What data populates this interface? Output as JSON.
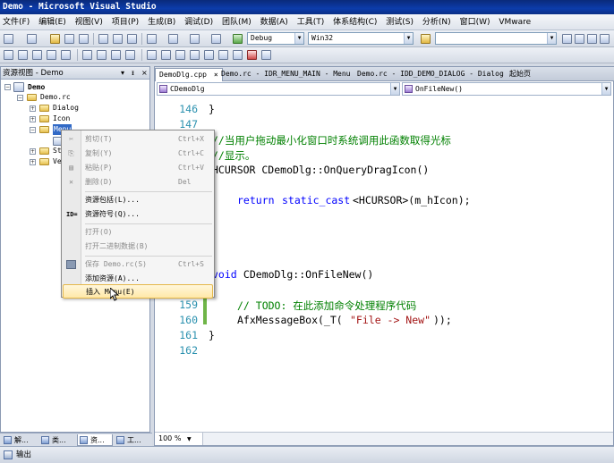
{
  "window": {
    "title": "Demo - Microsoft Visual Studio"
  },
  "menubar": [
    "文件(F)",
    "编辑(E)",
    "视图(V)",
    "项目(P)",
    "生成(B)",
    "调试(D)",
    "团队(M)",
    "数据(A)",
    "工具(T)",
    "体系结构(C)",
    "测试(S)",
    "分析(N)",
    "窗口(W)",
    "VMware"
  ],
  "toolbar": {
    "config": "Debug",
    "platform": "Win32"
  },
  "left_panel": {
    "title": "资源视图 - Demo",
    "controls": [
      "▾",
      "ᵻ",
      "×"
    ],
    "tree": {
      "root": "Demo",
      "rc": "Demo.rc",
      "items": [
        "Dialog",
        "Icon",
        "Menu",
        "Str",
        "Ver"
      ]
    },
    "bottom_tabs": [
      "解...",
      "类...",
      "资...",
      "工..."
    ]
  },
  "editor": {
    "tabs": [
      "DemoDlg.cpp",
      "Demo.rc - IDR_MENU_MAIN - Menu",
      "Demo.rc - IDD_DEMO_DIALOG - Dialog",
      "起始页"
    ],
    "nav_left": "CDemoDlg",
    "nav_right": "OnFileNew()",
    "zoom": "100 %",
    "lines": [
      {
        "no": "146",
        "text": "}"
      },
      {
        "no": "147",
        "text": ""
      },
      {
        "no": "",
        "text": "//当用户拖动最小化窗口时系统调用此函数取得光标"
      },
      {
        "no": "",
        "text": "//显示。"
      },
      {
        "no": "",
        "text": "HCURSOR CDemoDlg::OnQueryDragIcon()"
      },
      {
        "no": "",
        "text": ""
      },
      {
        "no": "",
        "text": "    return static_cast<HCURSOR>(m_hIcon);"
      },
      {
        "no": "",
        "text": ""
      },
      {
        "no": "",
        "text": ""
      },
      {
        "no": "",
        "text": ""
      },
      {
        "no": "",
        "text": "void CDemoDlg::OnFileNew()"
      },
      {
        "no": "",
        "text": ""
      },
      {
        "no": "159",
        "text": "    // TODO: 在此添加命令处理程序代码"
      },
      {
        "no": "160",
        "text": "    AfxMessageBox(_T(\"File -> New\"));"
      },
      {
        "no": "161",
        "text": "}"
      },
      {
        "no": "162",
        "text": ""
      }
    ],
    "code_parts": {
      "comment1": "//当用户拖动最小化窗口时系统调用此函数取得光标",
      "comment2": "//显示。",
      "func1": "HCURSOR CDemoDlg::OnQueryDragIcon()",
      "ret_kw": "return",
      "ret_sc": "static_cast",
      "ret_rest": "<HCURSOR>(m_hIcon);",
      "void_kw": "void",
      "func2": " CDemoDlg::OnFileNew()",
      "todo": "// TODO: 在此添加命令处理程序代码",
      "afx1": "AfxMessageBox(_T(",
      "afx_str": "\"File -> New\"",
      "afx2": "));",
      "brace_close": "}",
      "brace_open": "{"
    }
  },
  "context_menu": {
    "items": [
      {
        "label": "剪切(T)",
        "shortcut": "Ctrl+X",
        "disabled": true,
        "icon": "✂"
      },
      {
        "label": "复制(Y)",
        "shortcut": "Ctrl+C",
        "disabled": true,
        "icon": "⎘"
      },
      {
        "label": "粘贴(P)",
        "shortcut": "Ctrl+V",
        "disabled": true,
        "icon": "📋"
      },
      {
        "label": "删除(D)",
        "shortcut": "Del",
        "disabled": true,
        "icon": "✕"
      },
      {
        "label": "资源包括(L)...",
        "shortcut": "",
        "disabled": false,
        "icon": ""
      },
      {
        "label": "资源符号(Q)...",
        "shortcut": "",
        "disabled": false,
        "icon": "ID="
      },
      {
        "label": "打开(O)",
        "shortcut": "",
        "disabled": true,
        "icon": ""
      },
      {
        "label": "打开二进制数据(B)",
        "shortcut": "",
        "disabled": true,
        "icon": ""
      },
      {
        "label": "保存 Demo.rc(S)",
        "shortcut": "Ctrl+S",
        "disabled": true,
        "icon": "💾"
      },
      {
        "label": "添加资源(A)...",
        "shortcut": "",
        "disabled": false,
        "icon": ""
      },
      {
        "label": "插入 Menu(E)",
        "shortcut": "",
        "disabled": false,
        "icon": ""
      }
    ]
  },
  "output": {
    "label": "输出"
  }
}
